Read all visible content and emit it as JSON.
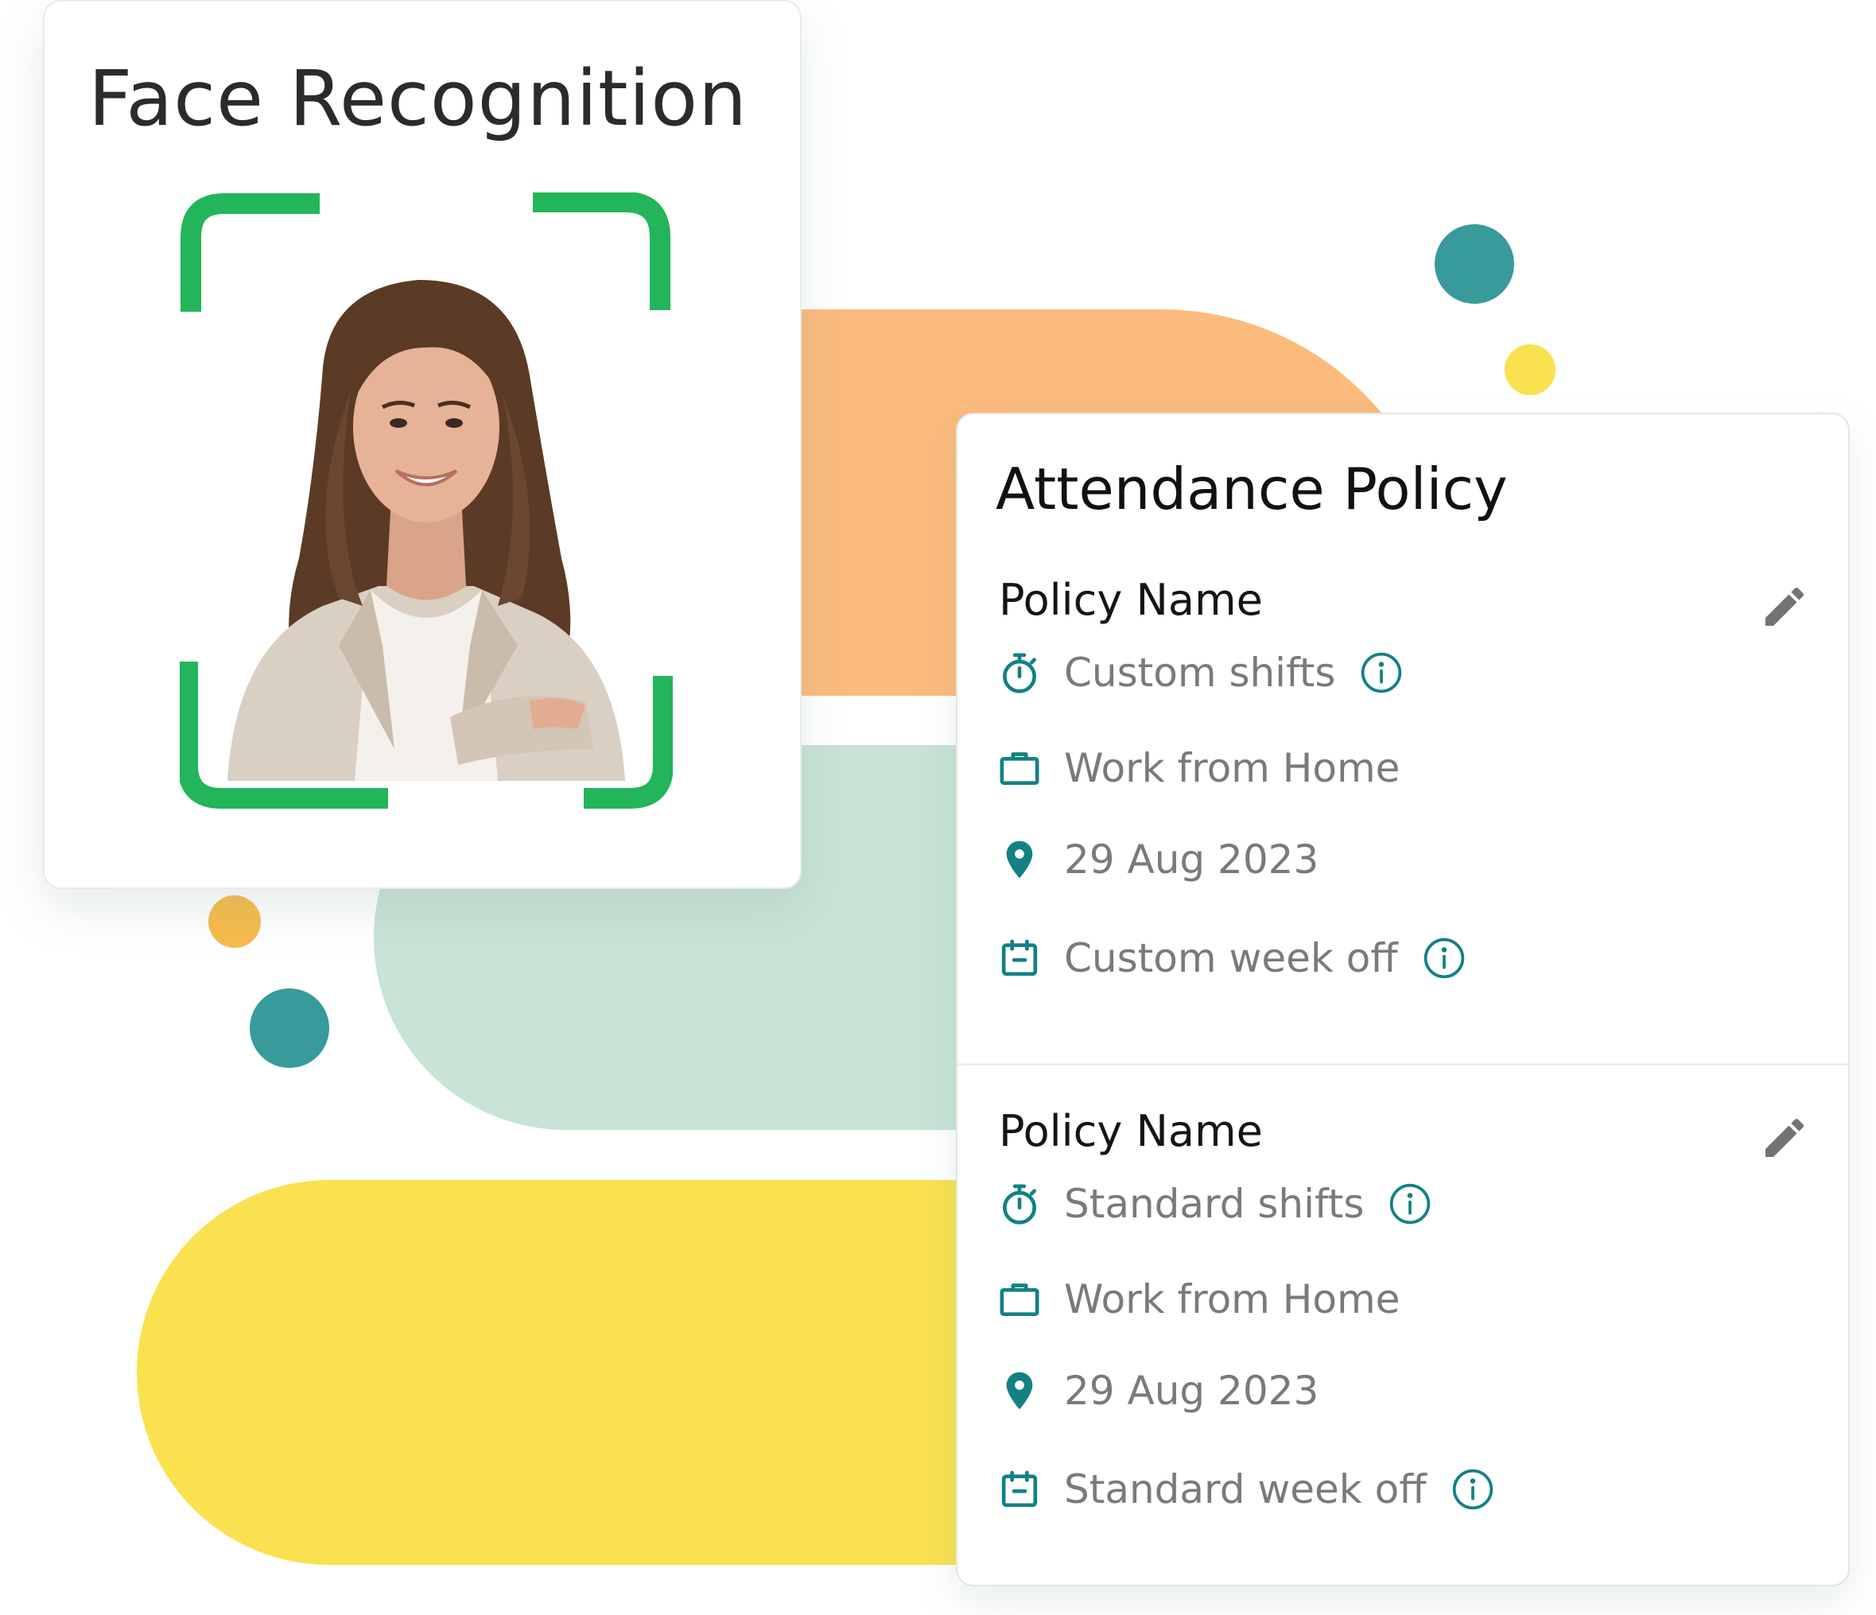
{
  "face_card": {
    "title": "Face Recognition",
    "photo_icon": "person-portrait"
  },
  "attendance": {
    "title": "Attendance Policy",
    "policies": [
      {
        "name": "Policy Name",
        "shift": "Custom shifts",
        "work_mode": "Work from Home",
        "date": "29 Aug 2023",
        "week_off": "Custom week off"
      },
      {
        "name": "Policy Name",
        "shift": "Standard shifts",
        "work_mode": "Work from Home",
        "date": "29 Aug 2023",
        "week_off": "Standard week off"
      }
    ]
  },
  "icons": {
    "shift": "stopwatch-icon",
    "work_mode": "briefcase-icon",
    "date": "location-pin-icon",
    "week_off": "calendar-icon",
    "info": "info-icon",
    "edit": "pencil-icon"
  },
  "colors": {
    "teal": "#138183",
    "scan_green": "#22b559",
    "orange": "#fcbb7d",
    "mint": "#c7e4d6",
    "yellow": "#fae14f"
  }
}
